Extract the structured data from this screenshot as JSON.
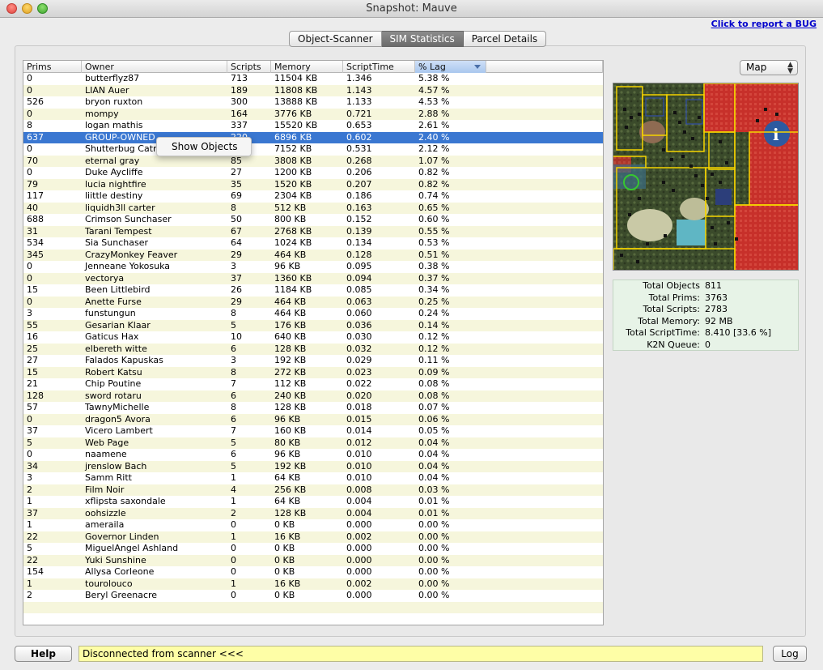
{
  "window": {
    "title": "Snapshot: Mauve"
  },
  "bug_link": "Click to report a BUG",
  "tabs": [
    {
      "label": "Object-Scanner",
      "active": false
    },
    {
      "label": "SIM Statistics",
      "active": true
    },
    {
      "label": "Parcel Details",
      "active": false
    }
  ],
  "table": {
    "headers": [
      "Prims",
      "Owner",
      "Scripts",
      "Memory",
      "ScriptTime",
      "% Lag"
    ],
    "sorted_column": "% Lag",
    "selected_row": 5,
    "rows": [
      [
        "0",
        "butterflyz87",
        "713",
        "11504 KB",
        "1.346",
        "5.38 %"
      ],
      [
        "0",
        "LIAN Auer",
        "189",
        "11808 KB",
        "1.143",
        "4.57 %"
      ],
      [
        "526",
        "bryon ruxton",
        "300",
        "13888 KB",
        "1.133",
        "4.53 %"
      ],
      [
        "0",
        "mompy",
        "164",
        "3776 KB",
        "0.721",
        "2.88 %"
      ],
      [
        "8",
        "logan mathis",
        "337",
        "15520 KB",
        "0.653",
        "2.61 %"
      ],
      [
        "637",
        "GROUP-OWNED",
        "220",
        "6896 KB",
        "0.602",
        "2.40 %"
      ],
      [
        "0",
        "Shutterbug Catr",
        "",
        "7152 KB",
        "0.531",
        "2.12 %"
      ],
      [
        "70",
        "eternal gray",
        "85",
        "3808 KB",
        "0.268",
        "1.07 %"
      ],
      [
        "0",
        "Duke Aycliffe",
        "27",
        "1200 KB",
        "0.206",
        "0.82 %"
      ],
      [
        "79",
        "lucia nightfire",
        "35",
        "1520 KB",
        "0.207",
        "0.82 %"
      ],
      [
        "117",
        "liittle destiny",
        "69",
        "2304 KB",
        "0.186",
        "0.74 %"
      ],
      [
        "40",
        "liquidh3ll carter",
        "8",
        "512 KB",
        "0.163",
        "0.65 %"
      ],
      [
        "688",
        "Crimson Sunchaser",
        "50",
        "800 KB",
        "0.152",
        "0.60 %"
      ],
      [
        "31",
        "Tarani Tempest",
        "67",
        "2768 KB",
        "0.139",
        "0.55 %"
      ],
      [
        "534",
        "Sia Sunchaser",
        "64",
        "1024 KB",
        "0.134",
        "0.53 %"
      ],
      [
        "345",
        "CrazyMonkey Feaver",
        "29",
        "464 KB",
        "0.128",
        "0.51 %"
      ],
      [
        "0",
        "Jenneane Yokosuka",
        "3",
        "96 KB",
        "0.095",
        "0.38 %"
      ],
      [
        "0",
        "vectorya",
        "37",
        "1360 KB",
        "0.094",
        "0.37 %"
      ],
      [
        "15",
        "Been Littlebird",
        "26",
        "1184 KB",
        "0.085",
        "0.34 %"
      ],
      [
        "0",
        "Anette Furse",
        "29",
        "464 KB",
        "0.063",
        "0.25 %"
      ],
      [
        "3",
        "funstungun",
        "8",
        "464 KB",
        "0.060",
        "0.24 %"
      ],
      [
        "55",
        "Gesarian Klaar",
        "5",
        "176 KB",
        "0.036",
        "0.14 %"
      ],
      [
        "16",
        "Gaticus Hax",
        "10",
        "640 KB",
        "0.030",
        "0.12 %"
      ],
      [
        "25",
        "elbereth witte",
        "6",
        "128 KB",
        "0.032",
        "0.12 %"
      ],
      [
        "27",
        "Falados Kapuskas",
        "3",
        "192 KB",
        "0.029",
        "0.11 %"
      ],
      [
        "15",
        "Robert Katsu",
        "8",
        "272 KB",
        "0.023",
        "0.09 %"
      ],
      [
        "21",
        "Chip Poutine",
        "7",
        "112 KB",
        "0.022",
        "0.08 %"
      ],
      [
        "128",
        "sword rotaru",
        "6",
        "240 KB",
        "0.020",
        "0.08 %"
      ],
      [
        "57",
        "TawnyMichelle",
        "8",
        "128 KB",
        "0.018",
        "0.07 %"
      ],
      [
        "0",
        "dragon5 Avora",
        "6",
        "96 KB",
        "0.015",
        "0.06 %"
      ],
      [
        "37",
        "Vicero Lambert",
        "7",
        "160 KB",
        "0.014",
        "0.05 %"
      ],
      [
        "5",
        "Web Page",
        "5",
        "80 KB",
        "0.012",
        "0.04 %"
      ],
      [
        "0",
        "naamene",
        "6",
        "96 KB",
        "0.010",
        "0.04 %"
      ],
      [
        "34",
        "jrenslow Bach",
        "5",
        "192 KB",
        "0.010",
        "0.04 %"
      ],
      [
        "3",
        "Samm Ritt",
        "1",
        "64 KB",
        "0.010",
        "0.04 %"
      ],
      [
        "2",
        "Film Noir",
        "4",
        "256 KB",
        "0.008",
        "0.03 %"
      ],
      [
        "1",
        "xflipsta saxondale",
        "1",
        "64 KB",
        "0.004",
        "0.01 %"
      ],
      [
        "37",
        "oohsizzle",
        "2",
        "128 KB",
        "0.004",
        "0.01 %"
      ],
      [
        "1",
        "ameraila",
        "0",
        "0 KB",
        "0.000",
        "0.00 %"
      ],
      [
        "22",
        "Governor Linden",
        "1",
        "16 KB",
        "0.002",
        "0.00 %"
      ],
      [
        "5",
        "MiguelAngel Ashland",
        "0",
        "0 KB",
        "0.000",
        "0.00 %"
      ],
      [
        "22",
        "Yuki Sunshine",
        "0",
        "0 KB",
        "0.000",
        "0.00 %"
      ],
      [
        "154",
        "Allysa Corleone",
        "0",
        "0 KB",
        "0.000",
        "0.00 %"
      ],
      [
        "1",
        "tourolouco",
        "1",
        "16 KB",
        "0.002",
        "0.00 %"
      ],
      [
        "2",
        "Beryl Greenacre",
        "0",
        "0 KB",
        "0.000",
        "0.00 %"
      ]
    ]
  },
  "context_menu": {
    "item": "Show Objects"
  },
  "map_select": {
    "value": "Map"
  },
  "map": {
    "info_icon": "info-icon",
    "colors": {
      "owned": "#c62828",
      "border": "#f5d400",
      "land": "#3d4a2c"
    }
  },
  "stats": [
    {
      "label": "Total Objects",
      "value": "811"
    },
    {
      "label": "Total Prims:",
      "value": "3763"
    },
    {
      "label": "Total Scripts:",
      "value": "2783"
    },
    {
      "label": "Total Memory:",
      "value": "92 MB"
    },
    {
      "label": "Total ScriptTime:",
      "value": "8.410 [33.6 %]"
    },
    {
      "label": "K2N Queue:",
      "value": "0"
    }
  ],
  "footer": {
    "help_label": "Help",
    "status_text": "Disconnected from scanner <<<",
    "log_label": "Log"
  },
  "colors": {
    "selection": "#3a77d1",
    "row_alt": "#f6f6dc",
    "status_bg": "#fefea6",
    "stats_bg": "#e7f3e7",
    "link": "#0000cc"
  }
}
